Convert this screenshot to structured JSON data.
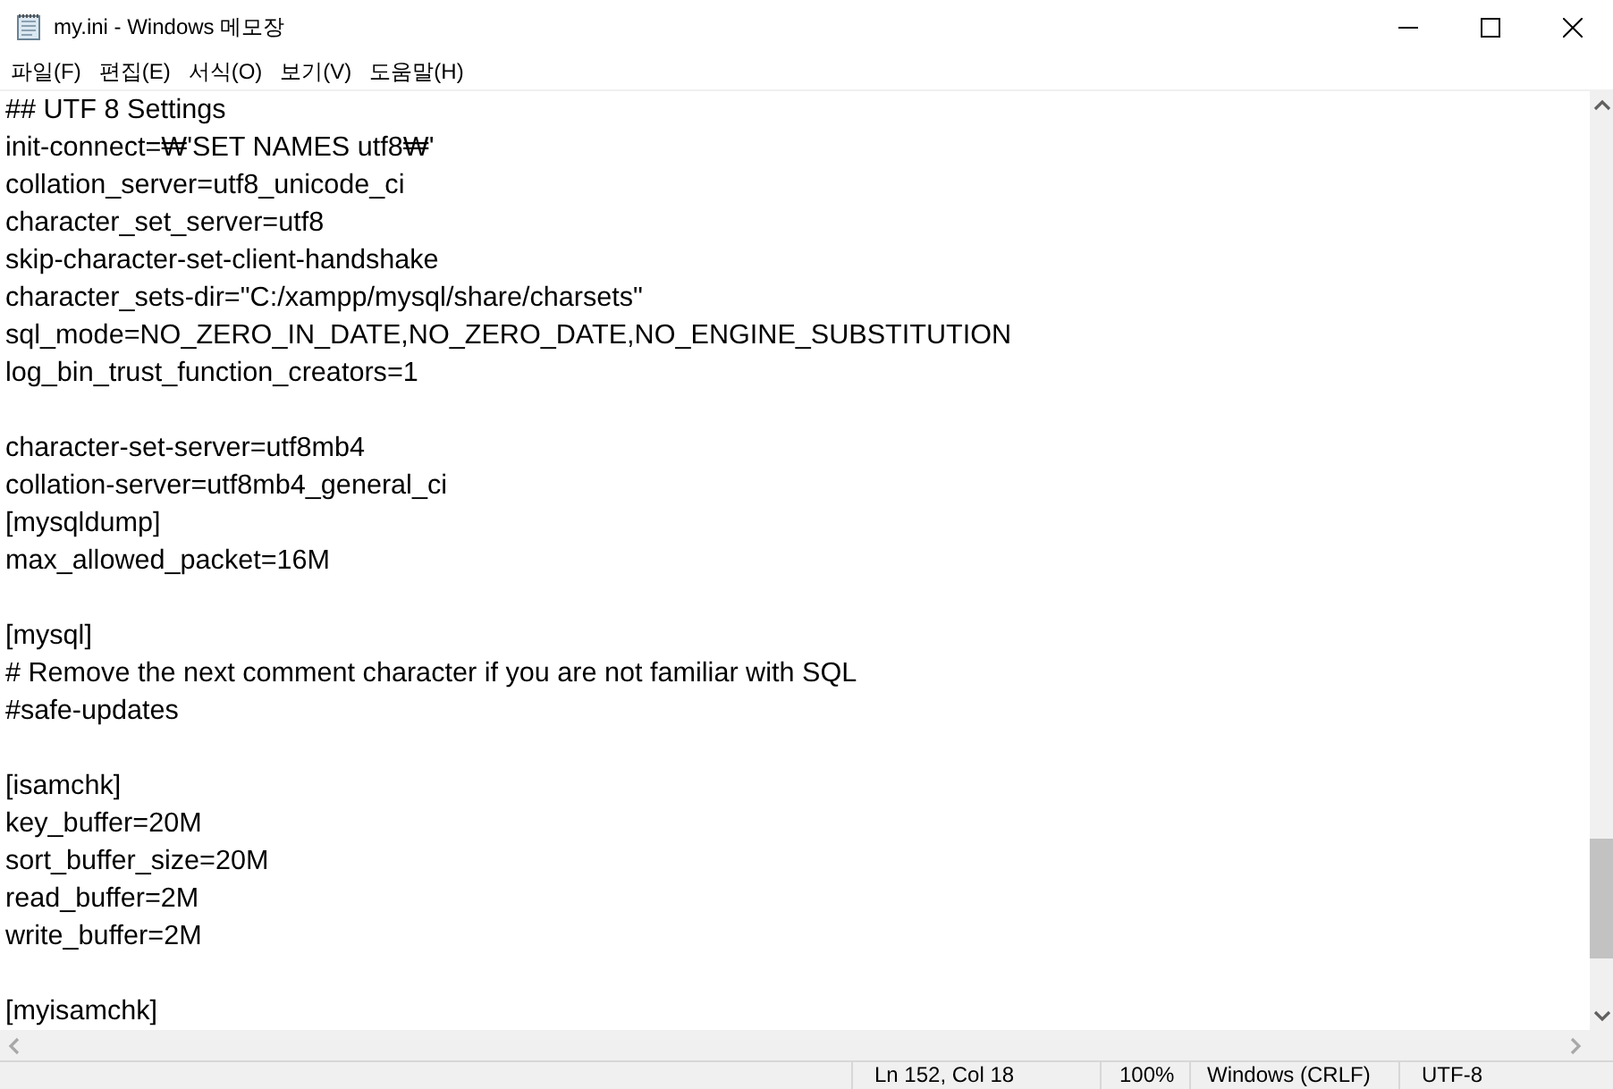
{
  "window": {
    "title": "my.ini - Windows 메모장"
  },
  "menu": [
    "파일(F)",
    "편집(E)",
    "서식(O)",
    "보기(V)",
    "도움말(H)"
  ],
  "lines": [
    {
      "kind": "text",
      "text": "## UTF 8 Settings"
    },
    {
      "kind": "text",
      "text": "init-connect=₩'SET NAMES utf8₩'"
    },
    {
      "kind": "text",
      "text": "collation_server=utf8_unicode_ci"
    },
    {
      "kind": "text",
      "text": "character_set_server=utf8"
    },
    {
      "kind": "text",
      "text": "skip-character-set-client-handshake"
    },
    {
      "kind": "text",
      "text": "character_sets-dir=\"C:/xampp/mysql/share/charsets\""
    },
    {
      "kind": "text",
      "text": "sql_mode=NO_ZERO_IN_DATE,NO_ZERO_DATE,NO_ENGINE_SUBSTITUTION"
    },
    {
      "kind": "text",
      "text": "log_bin_trust_function_creators=1"
    },
    {
      "kind": "blank"
    },
    {
      "kind": "text",
      "text": "character-set-server=utf8mb4"
    },
    {
      "kind": "text",
      "text": "collation-server=utf8mb4_general_ci"
    },
    {
      "kind": "text",
      "text": "[mysqldump]"
    },
    {
      "kind": "text",
      "text": "max_allowed_packet=16M"
    },
    {
      "kind": "blank"
    },
    {
      "kind": "text",
      "text": "[mysql]"
    },
    {
      "kind": "text",
      "text": "# Remove the next comment character if you are not familiar with SQL"
    },
    {
      "kind": "text",
      "text": "#safe-updates"
    },
    {
      "kind": "blank"
    },
    {
      "kind": "text",
      "text": "[isamchk]"
    },
    {
      "kind": "text",
      "text": "key_buffer=20M"
    },
    {
      "kind": "text",
      "text": "sort_buffer_size=20M"
    },
    {
      "kind": "text",
      "text": "read_buffer=2M"
    },
    {
      "kind": "text",
      "text": "write_buffer=2M"
    },
    {
      "kind": "blank"
    },
    {
      "kind": "text",
      "text": "[myisamchk]"
    }
  ],
  "status_bar": [
    "Ln 152, Col 18",
    "100%",
    "Windows (CRLF)",
    "UTF-8"
  ]
}
